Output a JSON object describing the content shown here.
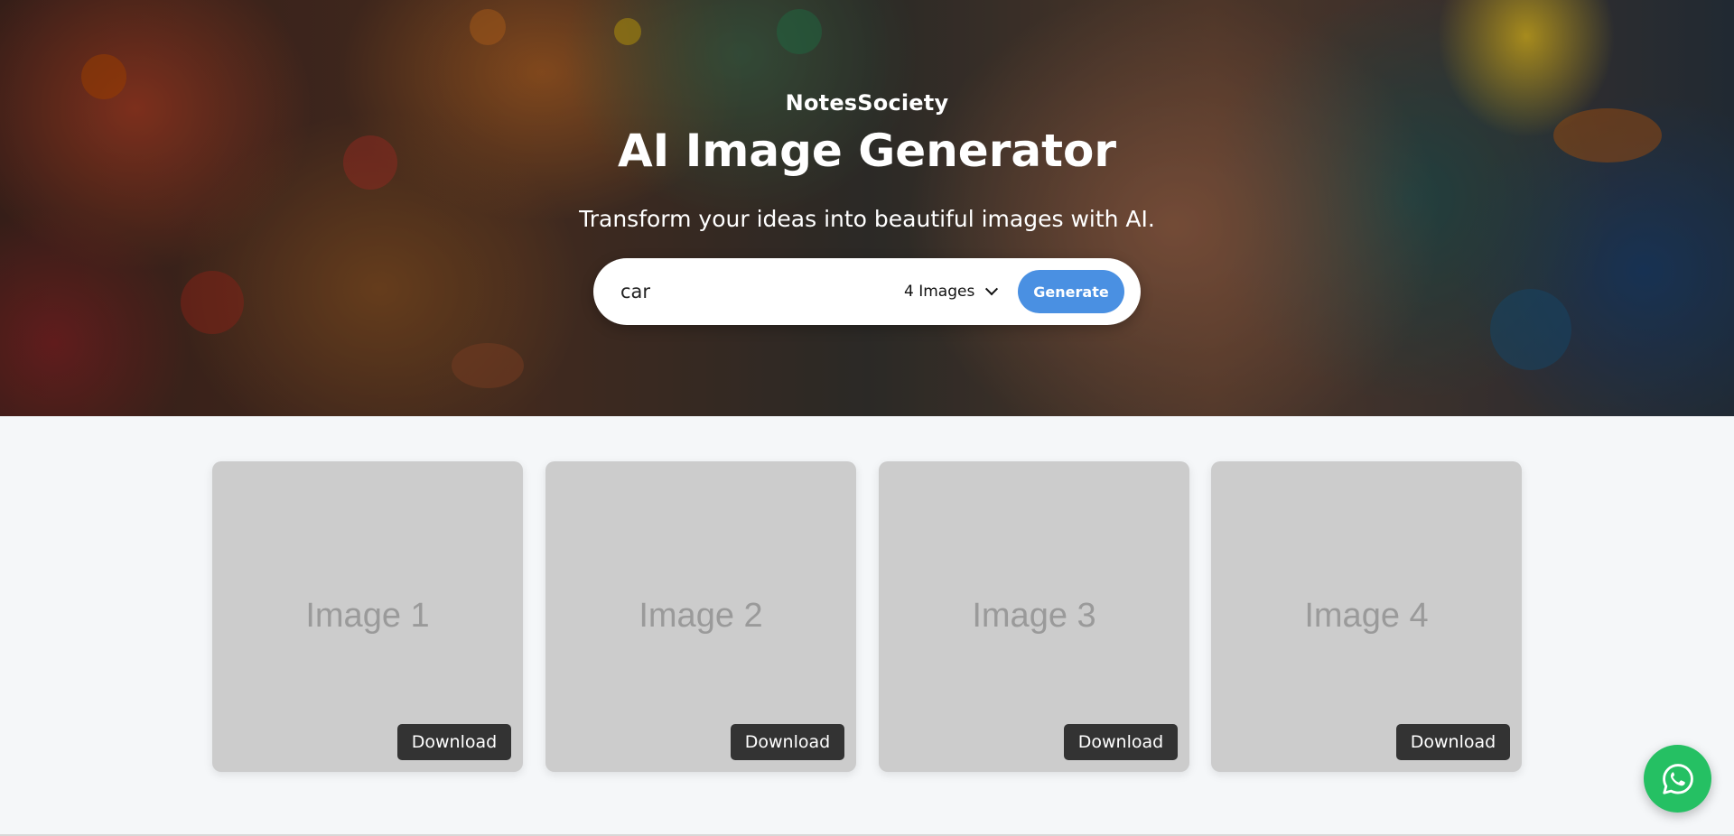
{
  "hero": {
    "brand": "NotesSociety",
    "title": "AI Image Generator",
    "subtitle": "Transform your ideas into beautiful images with AI."
  },
  "search": {
    "prompt_value": "car",
    "count_selected": "4 Images",
    "generate_label": "Generate"
  },
  "gallery": {
    "cards": [
      {
        "label": "Image 1",
        "download_label": "Download"
      },
      {
        "label": "Image 2",
        "download_label": "Download"
      },
      {
        "label": "Image 3",
        "download_label": "Download"
      },
      {
        "label": "Image 4",
        "download_label": "Download"
      }
    ]
  },
  "floating": {
    "icon": "whatsapp-icon"
  },
  "colors": {
    "accent": "#4a90e2",
    "card_bg": "#cccccc",
    "download_bg": "#333333",
    "whatsapp": "#25c063",
    "page_bg": "#f5f7f9"
  }
}
